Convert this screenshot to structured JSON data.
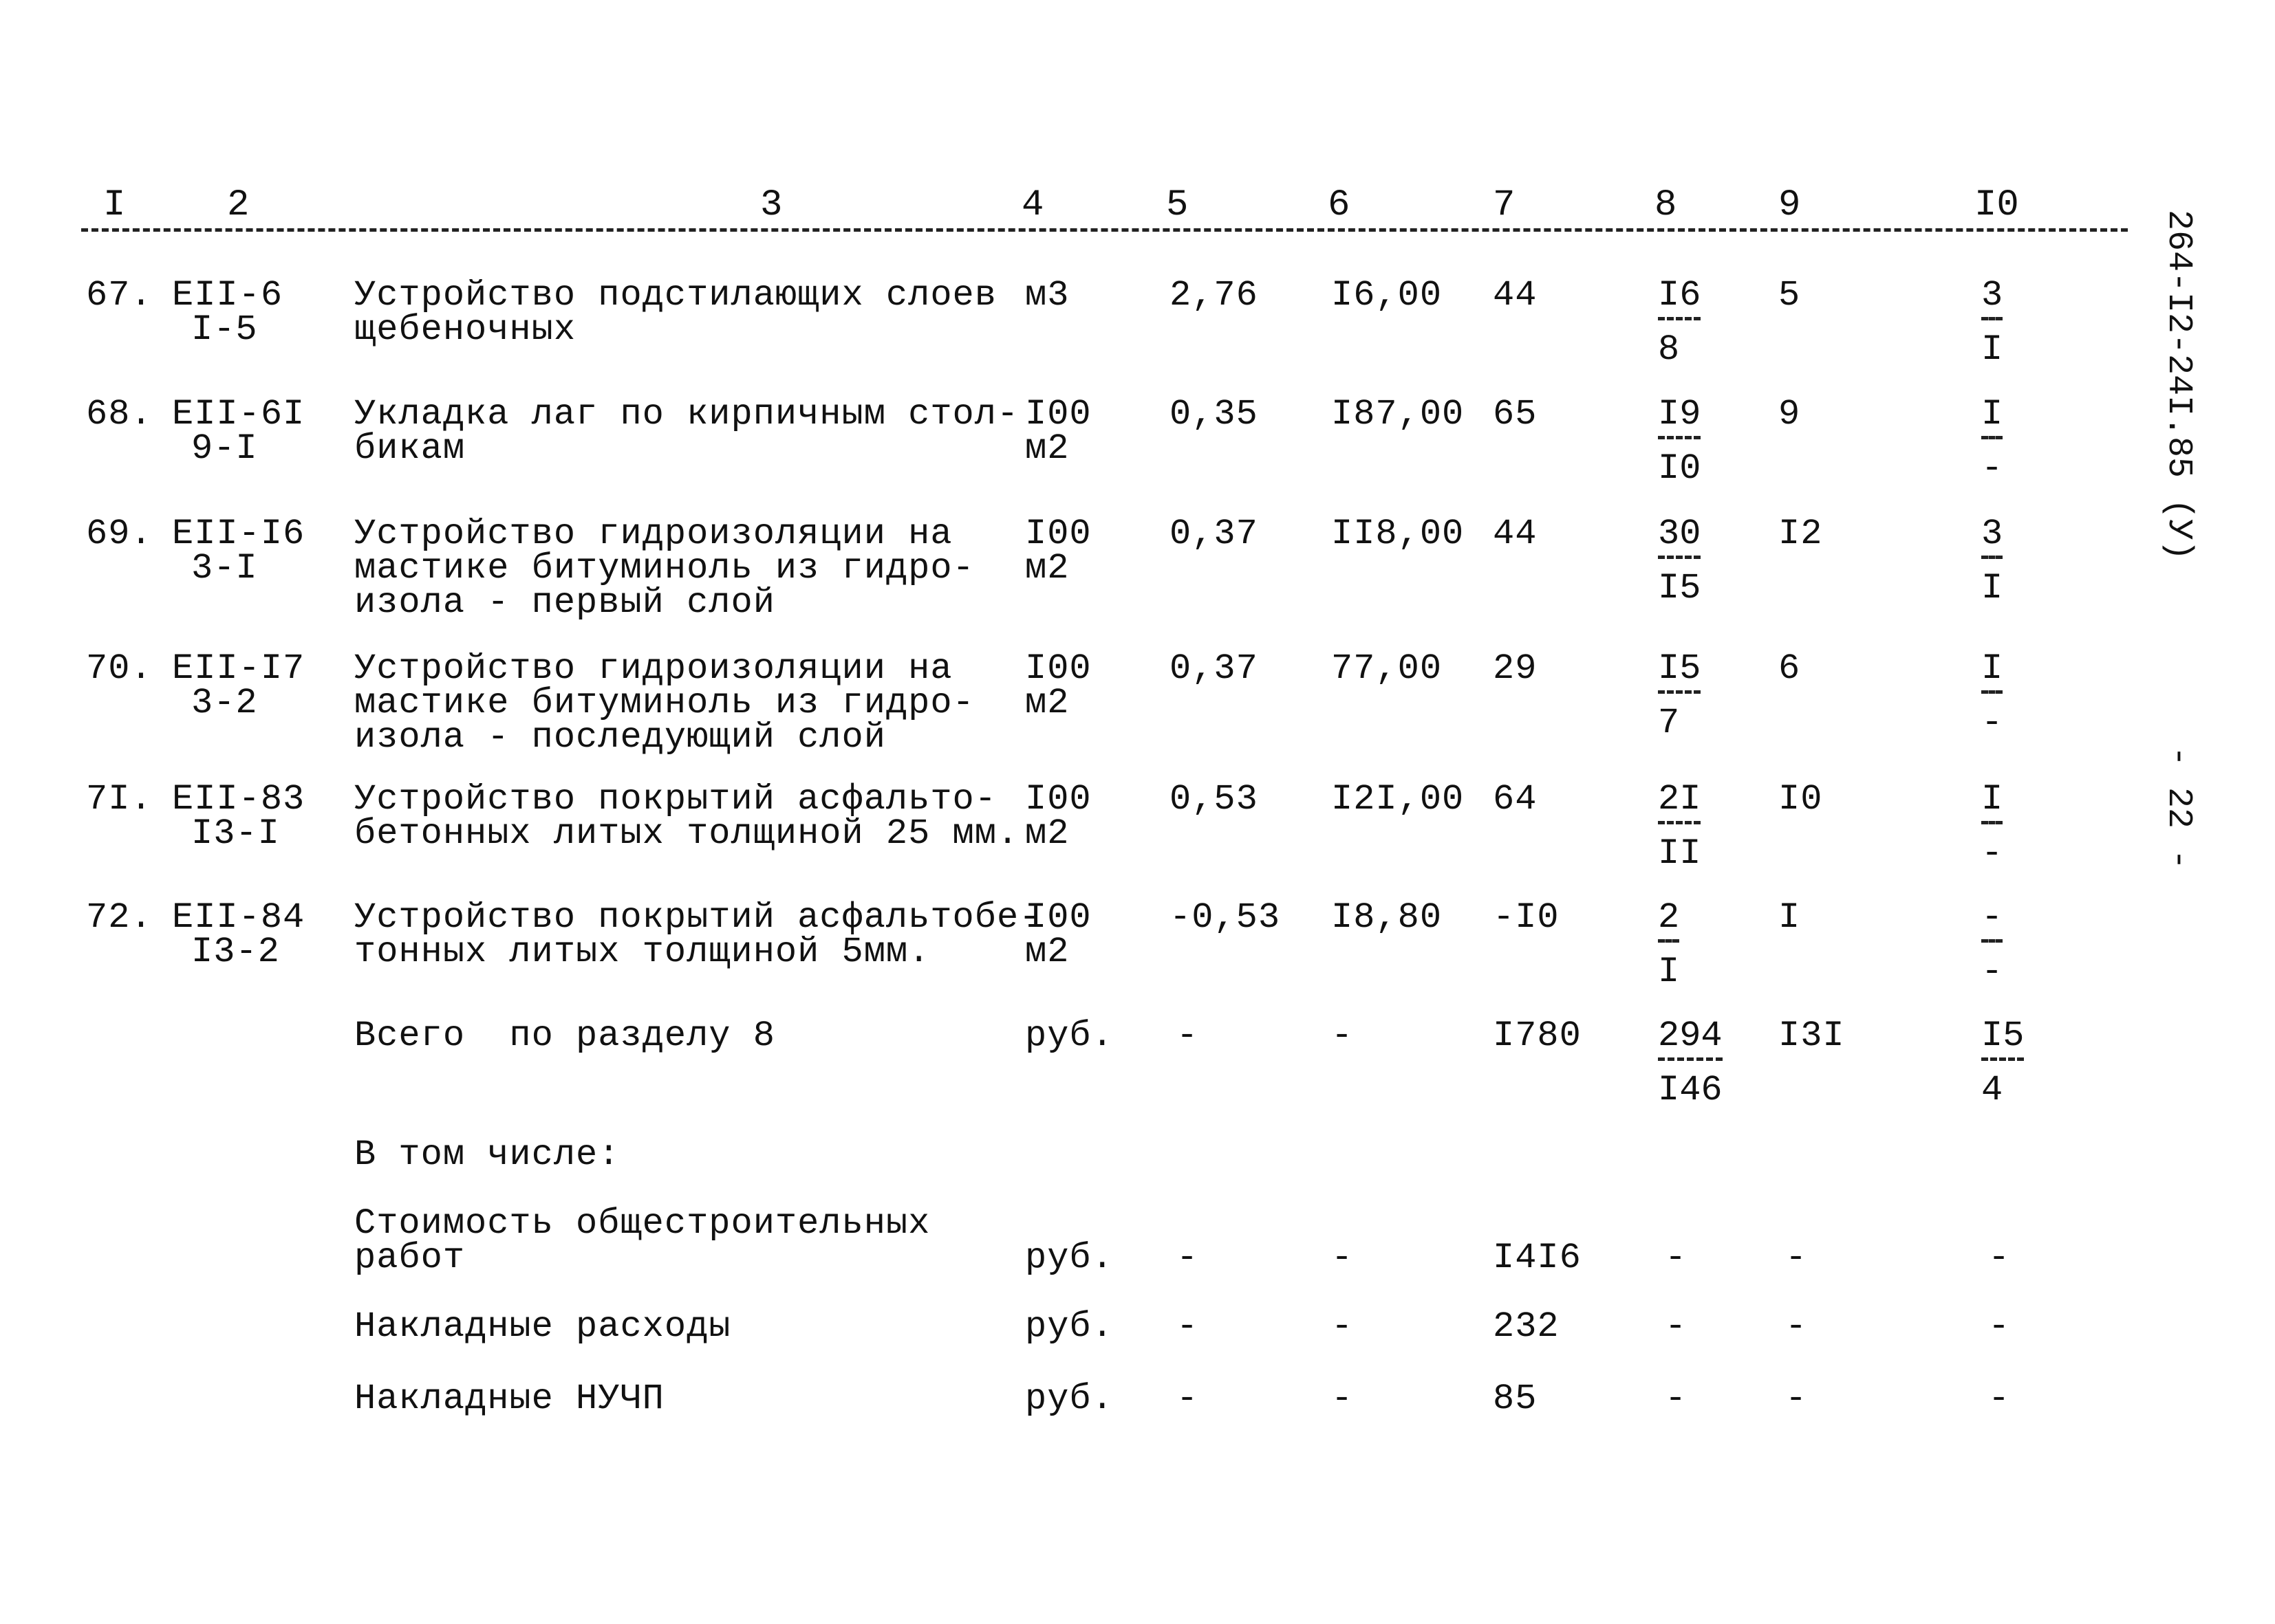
{
  "side_code": "264-I2-24I.85 (У)",
  "page_number": "- 22 -",
  "header": [
    "I",
    "2",
    "3",
    "4",
    "5",
    "6",
    "7",
    "8",
    "9",
    "I0"
  ],
  "rows": [
    {
      "no": "67.",
      "code1": "ЕII-6",
      "code2": "I-5",
      "desc": [
        "Устройство подстилающих слоев",
        "щебеночных"
      ],
      "unit": [
        "м3"
      ],
      "qty": "2,76",
      "price": "I6,00",
      "total": "44",
      "c8_num": "I6",
      "c8_den": "8",
      "c9": "5",
      "c10_num": "3",
      "c10_den": "I"
    },
    {
      "no": "68.",
      "code1": "ЕII-6I",
      "code2": "9-I",
      "desc": [
        "Укладка лаг по кирпичным стол-",
        "бикам"
      ],
      "unit": [
        "I00",
        "м2"
      ],
      "qty": "0,35",
      "price": "I87,00",
      "total": "65",
      "c8_num": "I9",
      "c8_den": "I0",
      "c9": "9",
      "c10_num": "I",
      "c10_den": "-"
    },
    {
      "no": "69.",
      "code1": "ЕII-I6",
      "code2": "3-I",
      "desc": [
        "Устройство гидроизоляции на",
        "мастике битуминоль из гидро-",
        "изола - первый слой"
      ],
      "unit": [
        "I00",
        "м2"
      ],
      "qty": "0,37",
      "price": "II8,00",
      "total": "44",
      "c8_num": "30",
      "c8_den": "I5",
      "c9": "I2",
      "c10_num": "3",
      "c10_den": "I"
    },
    {
      "no": "70.",
      "code1": "ЕII-I7",
      "code2": "3-2",
      "desc": [
        "Устройство гидроизоляции на",
        "мастике битуминоль из гидро-",
        "изола - последующий слой"
      ],
      "unit": [
        "I00",
        "м2"
      ],
      "qty": "0,37",
      "price": "77,00",
      "total": "29",
      "c8_num": "I5",
      "c8_den": "7",
      "c9": "6",
      "c10_num": "I",
      "c10_den": "-"
    },
    {
      "no": "7I.",
      "code1": "ЕII-83",
      "code2": "I3-I",
      "desc": [
        "Устройство покрытий асфальто-",
        "бетонных литых толщиной 25 мм."
      ],
      "unit": [
        "I00",
        "м2"
      ],
      "qty": "0,53",
      "price": "I2I,00",
      "total": "64",
      "c8_num": "2I",
      "c8_den": "II",
      "c9": "I0",
      "c10_num": "I",
      "c10_den": "-"
    },
    {
      "no": "72.",
      "code1": "ЕII-84",
      "code2": "I3-2",
      "desc": [
        "Устройство покрытий асфальтобе-",
        "тонных литых толщиной 5мм."
      ],
      "unit": [
        "I00",
        "м2"
      ],
      "qty": "-0,53",
      "price": "I8,80",
      "total": "-I0",
      "c8_num": "2",
      "c8_den": "I",
      "c9": "I",
      "c10_num": "-",
      "c10_den": "-"
    }
  ],
  "total": {
    "label": "Всего  по разделу 8",
    "unit": "руб.",
    "qty": "-",
    "price": "-",
    "total": "I780",
    "c8_num": "294",
    "c8_den": "I46",
    "c9": "I3I",
    "c10_num": "I5",
    "c10_den": "4"
  },
  "including_label": "В том числе:",
  "breakdown": [
    {
      "label": [
        "Стоимость общестроительных",
        "работ"
      ],
      "unit": "руб.",
      "qty": "-",
      "price": "-",
      "total": "I4I6",
      "c8": "-",
      "c9": "-",
      "c10": "-"
    },
    {
      "label": [
        "Накладные расходы"
      ],
      "unit": "руб.",
      "qty": "-",
      "price": "-",
      "total": "232",
      "c8": "-",
      "c9": "-",
      "c10": "-"
    },
    {
      "label": [
        "Накладные НУЧП"
      ],
      "unit": "руб.",
      "qty": "-",
      "price": "-",
      "total": "85",
      "c8": "-",
      "c9": "-",
      "c10": "-"
    }
  ]
}
